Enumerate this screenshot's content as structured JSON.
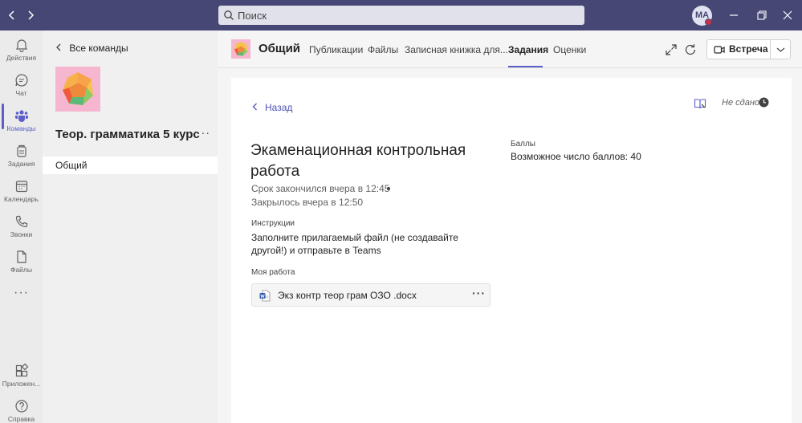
{
  "titlebar": {
    "search_placeholder": "Поиск",
    "user_initials": "MA",
    "presence_color": "#c4314b"
  },
  "rail": {
    "items": [
      {
        "label": "Действия",
        "icon": "bell-icon"
      },
      {
        "label": "Чат",
        "icon": "chat-icon"
      },
      {
        "label": "Команды",
        "icon": "teams-icon",
        "active": true
      },
      {
        "label": "Задания",
        "icon": "assignments-icon"
      },
      {
        "label": "Календарь",
        "icon": "calendar-icon"
      },
      {
        "label": "Звонки",
        "icon": "phone-icon"
      },
      {
        "label": "Файлы",
        "icon": "files-icon"
      },
      {
        "label": "Приложен...",
        "icon": "apps-icon"
      },
      {
        "label": "Справка",
        "icon": "help-icon"
      }
    ],
    "more_label": "···"
  },
  "team_panel": {
    "back_label": "Все команды",
    "team_name": "Теор. грамматика 5 курс",
    "more_label": "···",
    "channels": [
      "Общий"
    ]
  },
  "channel_header": {
    "title": "Общий",
    "tabs": [
      "Публикации",
      "Файлы",
      "Записная книжка для...",
      "Задания",
      "Оценки"
    ],
    "active_tab": "Задания",
    "meet_label": "Встреча"
  },
  "assignment": {
    "back_label": "Назад",
    "status": "Не сдано",
    "title": "Экаменационная контрольная работа",
    "due": "Срок закончился вчера в 12:45",
    "closed": "Закрылось вчера в 12:50",
    "instructions_label": "Инструкции",
    "instructions": "Заполните прилагаемый файл (не создавайте другой!) и отправьте в Teams",
    "points_label": "Баллы",
    "points_value": "Возможное число баллов: 40",
    "my_work_label": "Моя работа",
    "file_name": "Экз контр теор грам ОЗО .docx",
    "file_more": "···"
  },
  "colors": {
    "titlebar": "#464775",
    "accent": "#5b5fc7",
    "link": "#4f52b2"
  }
}
